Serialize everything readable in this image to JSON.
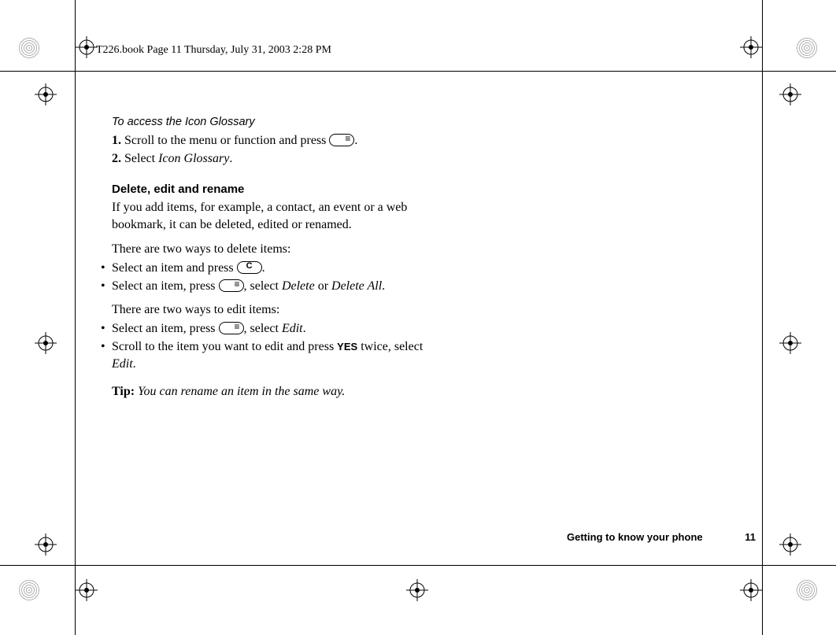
{
  "header": {
    "path": "T226.book  Page 11  Thursday, July 31, 2003  2:28 PM"
  },
  "content": {
    "access_title": "To access the Icon Glossary",
    "steps": [
      {
        "n": "1.",
        "before": "Scroll to the menu or function and press ",
        "key": "menu",
        "after": "."
      },
      {
        "n": "2.",
        "before": "Select ",
        "em": "Icon Glossary",
        "after": "."
      }
    ],
    "section_heading": "Delete, edit and rename",
    "intro": "If you add items, for example, a contact, an event or a web bookmark, it can be deleted, edited or renamed.",
    "delete_lead": "There are two ways to delete items:",
    "delete_items": [
      {
        "before": "Select an item and press ",
        "key": "c",
        "after": "."
      },
      {
        "before": "Select an item, press ",
        "key": "menu",
        "mid": ", select ",
        "em1": "Delete",
        "or": " or ",
        "em2": "Delete All",
        "after": "."
      }
    ],
    "edit_lead": "There are two ways to edit items:",
    "edit_items": [
      {
        "before": "Select an item, press ",
        "key": "menu",
        "mid": ", select ",
        "em": "Edit",
        "after": "."
      },
      {
        "before": "Scroll to the item you want to edit and press ",
        "yes": "YES",
        "mid": " twice, select ",
        "em": "Edit",
        "after": "."
      }
    ],
    "tip_label": "Tip:",
    "tip_body": " You can rename an item in the same way."
  },
  "footer": {
    "section": "Getting to know your phone",
    "page": "11"
  }
}
